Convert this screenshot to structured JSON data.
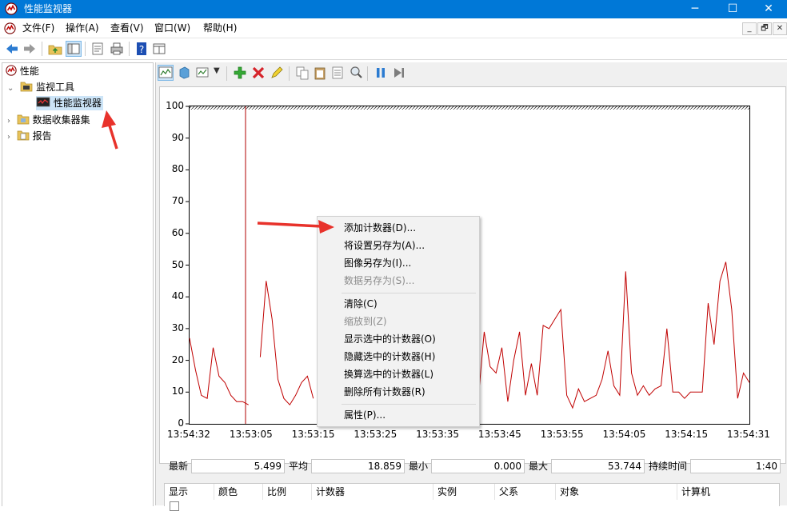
{
  "window": {
    "title": "性能监视器",
    "minimize": "─",
    "maximize": "☐",
    "close": "✕"
  },
  "menu": {
    "items": [
      "文件(F)",
      "操作(A)",
      "查看(V)",
      "窗口(W)",
      "帮助(H)"
    ],
    "mdi_minimize": "_",
    "mdi_restore": "🗗",
    "mdi_close": "✕"
  },
  "tree": {
    "root": "性能",
    "monitor_tools": "监视工具",
    "perf_monitor": "性能监视器",
    "collector_sets": "数据收集器集",
    "reports": "报告"
  },
  "graph": {
    "y_ticks": [
      "100",
      "90",
      "80",
      "70",
      "60",
      "50",
      "40",
      "30",
      "20",
      "10",
      "0"
    ],
    "x_ticks": [
      "13:54:32",
      "13:53:05",
      "13:53:15",
      "13:53:25",
      "13:53:35",
      "13:53:45",
      "13:53:55",
      "13:54:05",
      "13:54:15",
      "13:54:31"
    ],
    "line_color": "#c00000",
    "cursor_color": "#b00000"
  },
  "chart_data": {
    "type": "line",
    "ylim": [
      0,
      100
    ],
    "grid": false,
    "x": [
      "13:54:32",
      "13:53:05",
      "13:53:15",
      "13:53:25",
      "13:53:35",
      "13:53:45",
      "13:53:55",
      "13:54:05",
      "13:54:15",
      "13:54:31"
    ],
    "series": [
      {
        "values": [
          27,
          17,
          9,
          8,
          24,
          15,
          13,
          9,
          7,
          7,
          6,
          null,
          21,
          45,
          33,
          14,
          8,
          6,
          9,
          13,
          15,
          8,
          null,
          25,
          27,
          9,
          8,
          10,
          8,
          15,
          11,
          9,
          20,
          27,
          15,
          17,
          13,
          20,
          28,
          32,
          9,
          12,
          11,
          9,
          26,
          40,
          54,
          27,
          11,
          8,
          29,
          18,
          16,
          24,
          7,
          20,
          29,
          9,
          19,
          9,
          31,
          30,
          33,
          36,
          9,
          5,
          11,
          7,
          8,
          9,
          14,
          23,
          12,
          9,
          48,
          16,
          9,
          12,
          9,
          11,
          12,
          30,
          10,
          10,
          8,
          10,
          10,
          10,
          38,
          25,
          45,
          51,
          36,
          8,
          16,
          13
        ]
      }
    ]
  },
  "stats": {
    "last_label": "最新",
    "last_value": "5.499",
    "avg_label": "平均",
    "avg_value": "18.859",
    "min_label": "最小",
    "min_value": "0.000",
    "max_label": "最大",
    "max_value": "53.744",
    "dur_label": "持续时间",
    "dur_value": "1:40"
  },
  "table": {
    "columns": [
      "显示",
      "颜色",
      "比例",
      "计数器",
      "实例",
      "父系",
      "对象",
      "计算机"
    ]
  },
  "context_menu": {
    "add_counters": "添加计数器(D)...",
    "save_settings": "将设置另存为(A)...",
    "save_image": "图像另存为(I)...",
    "save_data": "数据另存为(S)...",
    "clear": "清除(C)",
    "zoom_to": "缩放到(Z)",
    "show_selected": "显示选中的计数器(O)",
    "hide_selected": "隐藏选中的计数器(H)",
    "scale_selected": "换算选中的计数器(L)",
    "remove_all": "删除所有计数器(R)",
    "properties": "属性(P)..."
  },
  "colors": {
    "accent": "#0078d7",
    "annotation": "#e8322b",
    "selection": "#cce4f7"
  }
}
